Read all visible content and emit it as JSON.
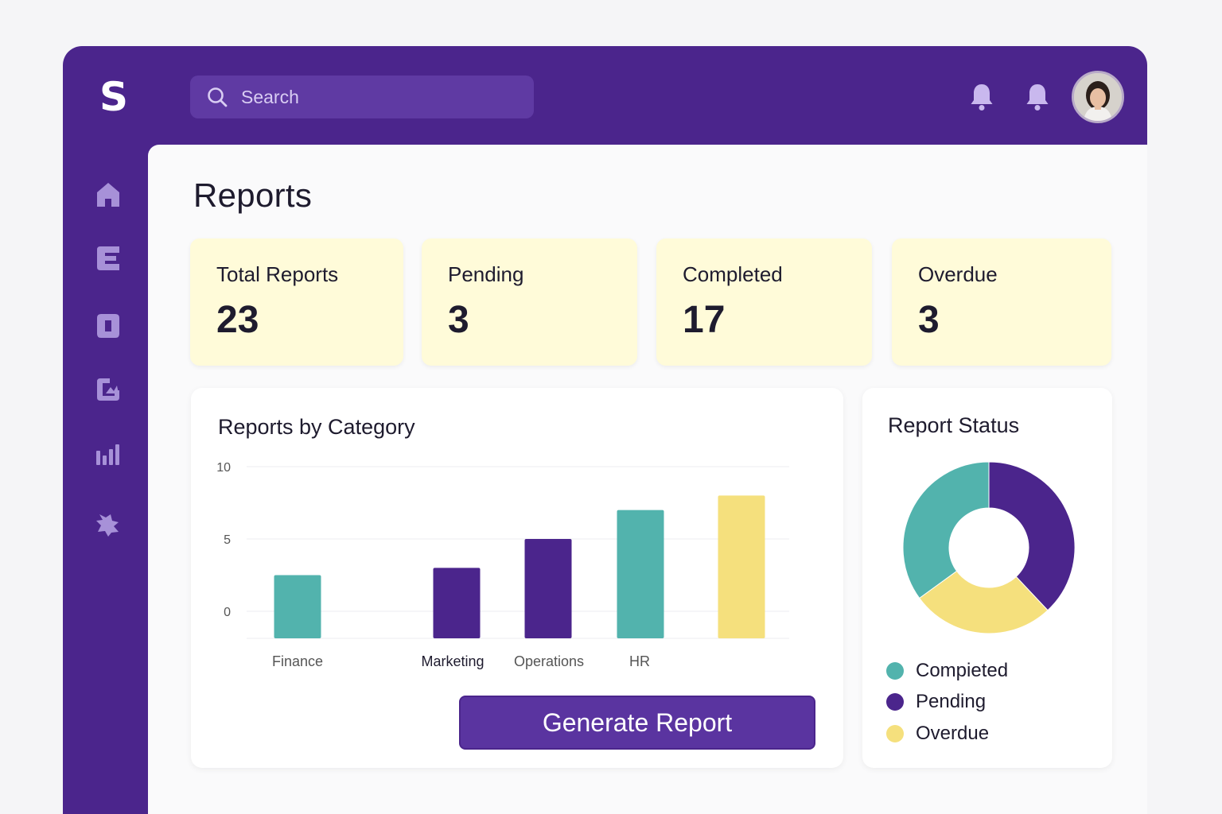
{
  "brand": {
    "logo": "S"
  },
  "search": {
    "placeholder": "Search"
  },
  "page": {
    "title": "Reports"
  },
  "stats": [
    {
      "label": "Total Reports",
      "value": "23"
    },
    {
      "label": "Pending",
      "value": "3"
    },
    {
      "label": "Completed",
      "value": "17"
    },
    {
      "label": "Overdue",
      "value": "3"
    }
  ],
  "bar_panel": {
    "title": "Reports by Category",
    "button_label": "Generate Report"
  },
  "status_panel": {
    "title": "Report Status",
    "legend": [
      {
        "label": "Compieted",
        "color": "#52b3ad"
      },
      {
        "label": "Pending",
        "color": "#4b258c"
      },
      {
        "label": "Overdue",
        "color": "#f5e07d"
      }
    ]
  },
  "icons": {
    "topbar": [
      "bell-icon",
      "bell-icon"
    ],
    "sidebar": [
      "home-icon",
      "reports-icon",
      "document-icon",
      "image-icon",
      "analytics-icon",
      "puzzle-icon"
    ]
  },
  "colors": {
    "primary": "#4b258c",
    "teal": "#52b3ad",
    "yellow": "#f5e07d",
    "card": "#fffbd9"
  },
  "chart_data": [
    {
      "type": "bar",
      "title": "Reports by Category",
      "categories": [
        "Finance",
        "",
        "Marketing",
        "Operations",
        "HR",
        ""
      ],
      "values": [
        2.5,
        null,
        3,
        5,
        7,
        8
      ],
      "colors": [
        "#52b3ad",
        null,
        "#4b258c",
        "#4b258c",
        "#52b3ad",
        "#f5e07d"
      ],
      "yticks": [
        10,
        5,
        0
      ],
      "grid": true
    },
    {
      "type": "pie",
      "title": "Report Status",
      "donut": true,
      "slices": [
        {
          "label": "Pending",
          "value": 38,
          "color": "#4b258c"
        },
        {
          "label": "Overdue",
          "value": 27,
          "color": "#f5e07d"
        },
        {
          "label": "Compieted",
          "value": 35,
          "color": "#52b3ad"
        }
      ]
    }
  ]
}
